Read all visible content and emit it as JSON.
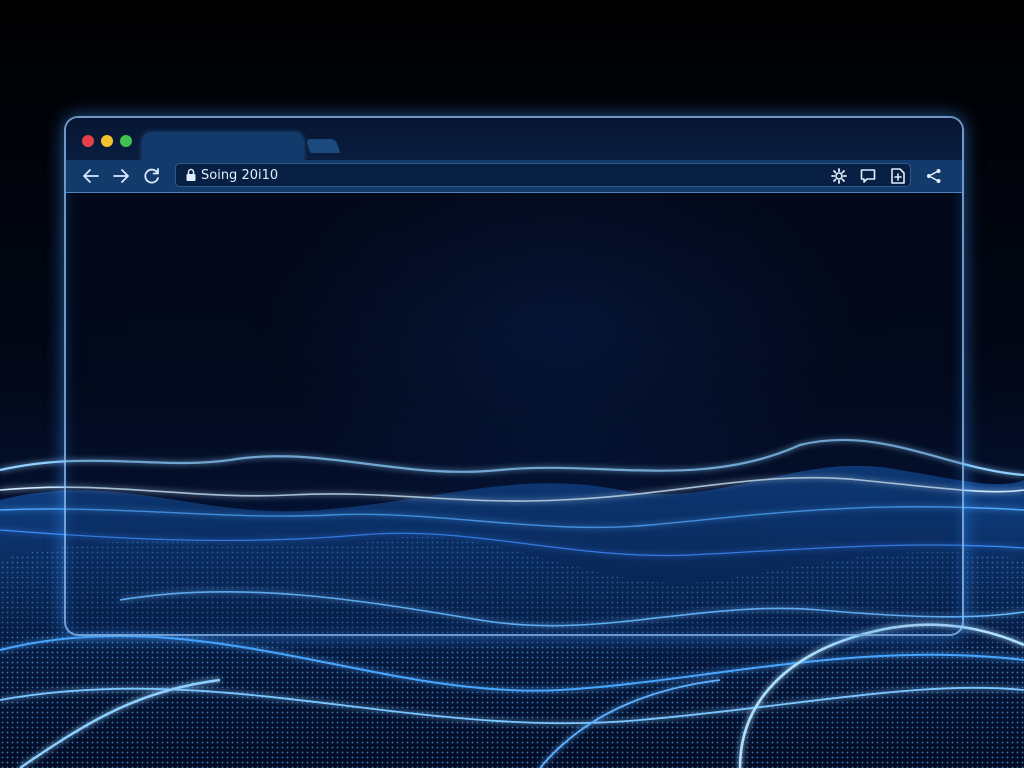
{
  "browser": {
    "window_controls": [
      {
        "name": "close",
        "color": "#e8404a"
      },
      {
        "name": "minimize",
        "color": "#f2c12e"
      },
      {
        "name": "maximize",
        "color": "#3fc24f"
      }
    ],
    "toolbar": {
      "back_icon": "arrow-left-icon",
      "forward_icon": "arrow-right-icon",
      "reload_icon": "reload-icon",
      "address": {
        "value": "Soing 20i10",
        "lock_icon": "lock-icon"
      },
      "actions": [
        {
          "name": "settings",
          "icon": "gear-icon"
        },
        {
          "name": "comments",
          "icon": "speech-bubble-icon"
        },
        {
          "name": "document",
          "icon": "document-icon"
        },
        {
          "name": "share",
          "icon": "share-icon"
        }
      ]
    }
  },
  "colors": {
    "frame_glow": "#6fb6ff",
    "wave": "#3fa2ff",
    "wave_bright": "#a8dcff"
  }
}
